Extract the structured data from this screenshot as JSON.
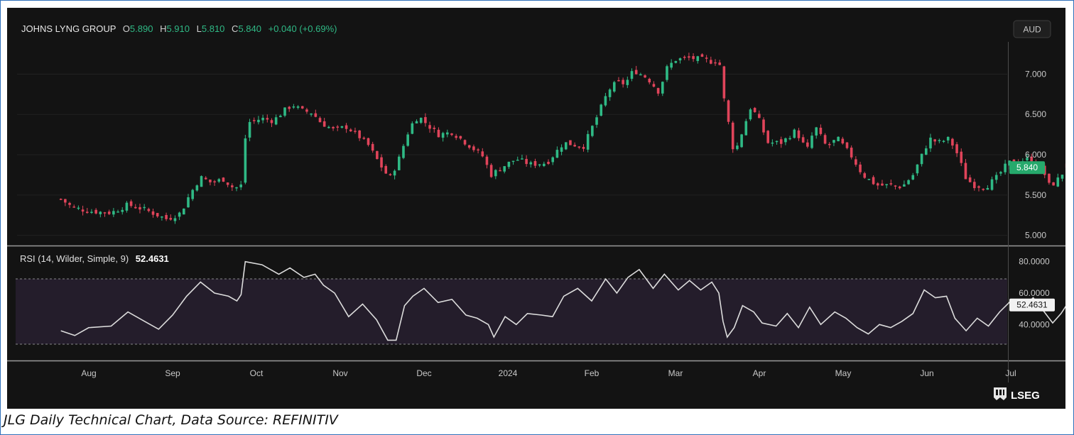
{
  "caption": "JLG Daily Technical Chart, Data Source: REFINITIV",
  "brand": {
    "name": "LSEG",
    "icon": "lseg-logo-icon"
  },
  "currency_button": "AUD",
  "legend": {
    "symbol": "JOHNS LYNG GROUP",
    "o_label": "O",
    "o_value": "5.890",
    "h_label": "H",
    "h_value": "5.910",
    "l_label": "L",
    "l_value": "5.810",
    "c_label": "C",
    "c_value": "5.840",
    "change": "+0.040 (+0.69%)"
  },
  "rsi_legend": {
    "label": "RSI (14, Wilder, Simple, 9)",
    "value": "52.4631"
  },
  "last_price_tag": "5.840",
  "last_rsi_tag": "52.4631",
  "colors": {
    "background": "#131313",
    "up": "#2fb985",
    "down": "#e0445a",
    "rsi_line": "#dcdcdc",
    "rsi_band": "#241d2b",
    "accent_green": "#26a96c"
  },
  "chart_data": [
    {
      "type": "candlestick",
      "title": "JOHNS LYNG GROUP",
      "ylabel": "AUD",
      "ylim": [
        4.9,
        7.4
      ],
      "yticks": [
        "5.000",
        "5.500",
        "6.000",
        "6.500",
        "7.000"
      ],
      "xticks": [
        "Aug",
        "Sep",
        "Oct",
        "Nov",
        "Dec",
        "2024",
        "Feb",
        "Mar",
        "Apr",
        "May",
        "Jun",
        "Jul"
      ],
      "last": {
        "open": 5.89,
        "high": 5.91,
        "low": 5.81,
        "close": 5.84,
        "change": 0.04,
        "change_pct": 0.69
      },
      "close_path": [
        {
          "t": 0,
          "c": 5.45
        },
        {
          "t": 0.4,
          "c": 5.35
        },
        {
          "t": 1,
          "c": 5.3
        },
        {
          "t": 1.8,
          "c": 5.28
        },
        {
          "t": 2.4,
          "c": 5.38
        },
        {
          "t": 3,
          "c": 5.32
        },
        {
          "t": 3.8,
          "c": 5.2
        },
        {
          "t": 4.3,
          "c": 5.28
        },
        {
          "t": 4.6,
          "c": 5.5
        },
        {
          "t": 5,
          "c": 5.72
        },
        {
          "t": 5.4,
          "c": 5.65
        },
        {
          "t": 5.8,
          "c": 5.7
        },
        {
          "t": 6.2,
          "c": 5.58
        },
        {
          "t": 6.45,
          "c": 5.62
        },
        {
          "t": 6.55,
          "c": 6.1
        },
        {
          "t": 6.7,
          "c": 6.4
        },
        {
          "t": 7.2,
          "c": 6.45
        },
        {
          "t": 7.6,
          "c": 6.42
        },
        {
          "t": 8,
          "c": 6.55
        },
        {
          "t": 8.3,
          "c": 6.62
        },
        {
          "t": 8.6,
          "c": 6.55
        },
        {
          "t": 9,
          "c": 6.52
        },
        {
          "t": 9.3,
          "c": 6.4
        },
        {
          "t": 9.8,
          "c": 6.3
        },
        {
          "t": 10.2,
          "c": 6.35
        },
        {
          "t": 10.6,
          "c": 6.25
        },
        {
          "t": 11,
          "c": 6.12
        },
        {
          "t": 11.3,
          "c": 5.95
        },
        {
          "t": 11.6,
          "c": 5.78
        },
        {
          "t": 11.8,
          "c": 5.72
        },
        {
          "t": 12.1,
          "c": 5.95
        },
        {
          "t": 12.5,
          "c": 6.35
        },
        {
          "t": 12.8,
          "c": 6.48
        },
        {
          "t": 13.1,
          "c": 6.38
        },
        {
          "t": 13.5,
          "c": 6.25
        },
        {
          "t": 14,
          "c": 6.28
        },
        {
          "t": 14.6,
          "c": 6.12
        },
        {
          "t": 15.1,
          "c": 5.98
        },
        {
          "t": 15.4,
          "c": 5.75
        },
        {
          "t": 15.8,
          "c": 5.85
        },
        {
          "t": 16.3,
          "c": 5.95
        },
        {
          "t": 16.8,
          "c": 5.88
        },
        {
          "t": 17.4,
          "c": 5.9
        },
        {
          "t": 18,
          "c": 6.15
        },
        {
          "t": 18.7,
          "c": 6.1
        },
        {
          "t": 19.2,
          "c": 6.48
        },
        {
          "t": 19.6,
          "c": 6.8
        },
        {
          "t": 19.9,
          "c": 6.9
        },
        {
          "t": 20.2,
          "c": 6.88
        },
        {
          "t": 20.5,
          "c": 7.05
        },
        {
          "t": 21,
          "c": 6.95
        },
        {
          "t": 21.4,
          "c": 6.78
        },
        {
          "t": 21.7,
          "c": 7.08
        },
        {
          "t": 22,
          "c": 7.18
        },
        {
          "t": 22.5,
          "c": 7.2
        },
        {
          "t": 23,
          "c": 7.18
        },
        {
          "t": 23.35,
          "c": 7.15
        },
        {
          "t": 23.55,
          "c": 7.2
        },
        {
          "t": 23.75,
          "c": 6.65
        },
        {
          "t": 23.95,
          "c": 6.3
        },
        {
          "t": 24.1,
          "c": 6.0
        },
        {
          "t": 24.4,
          "c": 6.3
        },
        {
          "t": 24.7,
          "c": 6.6
        },
        {
          "t": 25,
          "c": 6.42
        },
        {
          "t": 25.3,
          "c": 6.15
        },
        {
          "t": 25.8,
          "c": 6.15
        },
        {
          "t": 26.3,
          "c": 6.3
        },
        {
          "t": 26.7,
          "c": 6.05
        },
        {
          "t": 27,
          "c": 6.35
        },
        {
          "t": 27.4,
          "c": 6.1
        },
        {
          "t": 27.8,
          "c": 6.2
        },
        {
          "t": 28.3,
          "c": 5.98
        },
        {
          "t": 28.7,
          "c": 5.75
        },
        {
          "t": 29.2,
          "c": 5.62
        },
        {
          "t": 29.7,
          "c": 5.62
        },
        {
          "t": 30.1,
          "c": 5.6
        },
        {
          "t": 30.5,
          "c": 5.75
        },
        {
          "t": 30.8,
          "c": 5.98
        },
        {
          "t": 31.1,
          "c": 6.2
        },
        {
          "t": 31.4,
          "c": 6.15
        },
        {
          "t": 31.8,
          "c": 6.2
        },
        {
          "t": 32.1,
          "c": 6.0
        },
        {
          "t": 32.4,
          "c": 5.7
        },
        {
          "t": 32.7,
          "c": 5.62
        },
        {
          "t": 33.1,
          "c": 5.6
        },
        {
          "t": 33.5,
          "c": 5.72
        },
        {
          "t": 33.9,
          "c": 5.9
        },
        {
          "t": 34.3,
          "c": 5.92
        },
        {
          "t": 34.7,
          "c": 5.95
        },
        {
          "t": 35.1,
          "c": 5.85
        },
        {
          "t": 35.4,
          "c": 5.6
        },
        {
          "t": 35.7,
          "c": 5.7
        },
        {
          "t": 36,
          "c": 5.84
        }
      ]
    },
    {
      "type": "line",
      "title": "RSI (14, Wilder, Simple, 9)",
      "ylim": [
        18,
        88
      ],
      "yticks": [
        "40.0000",
        "60.0000",
        "80.0000"
      ],
      "band": [
        30,
        70
      ],
      "last": 52.4631,
      "points": [
        {
          "t": 0,
          "v": 36
        },
        {
          "t": 0.5,
          "v": 33
        },
        {
          "t": 1,
          "v": 38
        },
        {
          "t": 1.8,
          "v": 39
        },
        {
          "t": 2.4,
          "v": 48
        },
        {
          "t": 3,
          "v": 42
        },
        {
          "t": 3.5,
          "v": 37
        },
        {
          "t": 4,
          "v": 46
        },
        {
          "t": 4.5,
          "v": 58
        },
        {
          "t": 5,
          "v": 67
        },
        {
          "t": 5.5,
          "v": 60
        },
        {
          "t": 6,
          "v": 58
        },
        {
          "t": 6.3,
          "v": 55
        },
        {
          "t": 6.45,
          "v": 59
        },
        {
          "t": 6.6,
          "v": 80
        },
        {
          "t": 7.2,
          "v": 78
        },
        {
          "t": 7.8,
          "v": 72
        },
        {
          "t": 8.2,
          "v": 76
        },
        {
          "t": 8.7,
          "v": 70
        },
        {
          "t": 9.1,
          "v": 72
        },
        {
          "t": 9.4,
          "v": 65
        },
        {
          "t": 9.8,
          "v": 60
        },
        {
          "t": 10.3,
          "v": 45
        },
        {
          "t": 10.8,
          "v": 53
        },
        {
          "t": 11.3,
          "v": 43
        },
        {
          "t": 11.7,
          "v": 30
        },
        {
          "t": 12,
          "v": 30
        },
        {
          "t": 12.3,
          "v": 52
        },
        {
          "t": 12.6,
          "v": 58
        },
        {
          "t": 13,
          "v": 63
        },
        {
          "t": 13.5,
          "v": 54
        },
        {
          "t": 14,
          "v": 56
        },
        {
          "t": 14.5,
          "v": 46
        },
        {
          "t": 14.9,
          "v": 44
        },
        {
          "t": 15.3,
          "v": 40
        },
        {
          "t": 15.5,
          "v": 32
        },
        {
          "t": 15.9,
          "v": 45
        },
        {
          "t": 16.3,
          "v": 40
        },
        {
          "t": 16.7,
          "v": 47
        },
        {
          "t": 17.2,
          "v": 46
        },
        {
          "t": 17.6,
          "v": 45
        },
        {
          "t": 18,
          "v": 58
        },
        {
          "t": 18.5,
          "v": 63
        },
        {
          "t": 19,
          "v": 55
        },
        {
          "t": 19.5,
          "v": 69
        },
        {
          "t": 19.9,
          "v": 60
        },
        {
          "t": 20.3,
          "v": 70
        },
        {
          "t": 20.7,
          "v": 75
        },
        {
          "t": 21.2,
          "v": 63
        },
        {
          "t": 21.6,
          "v": 72
        },
        {
          "t": 22.1,
          "v": 62
        },
        {
          "t": 22.5,
          "v": 68
        },
        {
          "t": 22.9,
          "v": 62
        },
        {
          "t": 23.3,
          "v": 67
        },
        {
          "t": 23.55,
          "v": 60
        },
        {
          "t": 23.7,
          "v": 42
        },
        {
          "t": 23.85,
          "v": 32
        },
        {
          "t": 24.1,
          "v": 38
        },
        {
          "t": 24.4,
          "v": 52
        },
        {
          "t": 24.8,
          "v": 48
        },
        {
          "t": 25.1,
          "v": 41
        },
        {
          "t": 25.6,
          "v": 39
        },
        {
          "t": 26,
          "v": 47
        },
        {
          "t": 26.4,
          "v": 38
        },
        {
          "t": 26.8,
          "v": 51
        },
        {
          "t": 27.2,
          "v": 40
        },
        {
          "t": 27.7,
          "v": 48
        },
        {
          "t": 28.1,
          "v": 44
        },
        {
          "t": 28.5,
          "v": 38
        },
        {
          "t": 28.9,
          "v": 34
        },
        {
          "t": 29.3,
          "v": 40
        },
        {
          "t": 29.7,
          "v": 38
        },
        {
          "t": 30.1,
          "v": 42
        },
        {
          "t": 30.5,
          "v": 47
        },
        {
          "t": 30.9,
          "v": 62
        },
        {
          "t": 31.3,
          "v": 57
        },
        {
          "t": 31.7,
          "v": 58
        },
        {
          "t": 32,
          "v": 44
        },
        {
          "t": 32.4,
          "v": 36
        },
        {
          "t": 32.8,
          "v": 44
        },
        {
          "t": 33.2,
          "v": 39
        },
        {
          "t": 33.6,
          "v": 48
        },
        {
          "t": 34,
          "v": 55
        },
        {
          "t": 34.4,
          "v": 50
        },
        {
          "t": 34.8,
          "v": 57
        },
        {
          "t": 35.2,
          "v": 48
        },
        {
          "t": 35.5,
          "v": 41
        },
        {
          "t": 35.8,
          "v": 47
        },
        {
          "t": 36,
          "v": 52.4631
        }
      ]
    }
  ]
}
